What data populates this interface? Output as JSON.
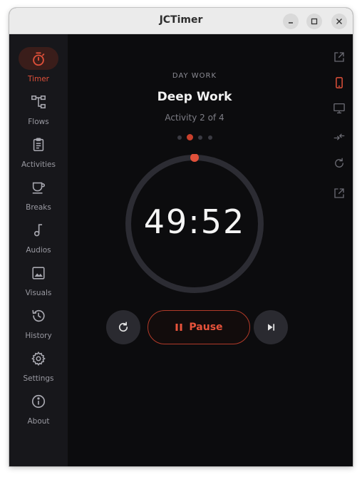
{
  "window": {
    "title": "JCTimer"
  },
  "sidebar": {
    "items": [
      {
        "label": "Timer",
        "icon": "stopwatch-icon",
        "active": true
      },
      {
        "label": "Flows",
        "icon": "flow-icon"
      },
      {
        "label": "Activities",
        "icon": "clipboard-icon"
      },
      {
        "label": "Breaks",
        "icon": "coffee-cup-icon"
      },
      {
        "label": "Audios",
        "icon": "music-note-icon"
      },
      {
        "label": "Visuals",
        "icon": "image-icon"
      },
      {
        "label": "History",
        "icon": "history-icon"
      },
      {
        "label": "Settings",
        "icon": "gear-icon"
      },
      {
        "label": "About",
        "icon": "info-icon"
      }
    ]
  },
  "timer": {
    "flow_name": "DAY WORK",
    "activity_name": "Deep Work",
    "activity_progress": "Activity 2 of 4",
    "time_remaining": "49:52",
    "current_step": 2,
    "total_steps": 4,
    "pause_label": "Pause"
  },
  "right_rail": {
    "icons": [
      "external-link-icon",
      "phone-icon",
      "monitor-icon",
      "swap-arrows-icon",
      "refresh-icon",
      "external-link-icon"
    ]
  },
  "colors": {
    "accent": "#e0503a",
    "background": "#0c0c0e",
    "sidebar": "#17171b"
  }
}
